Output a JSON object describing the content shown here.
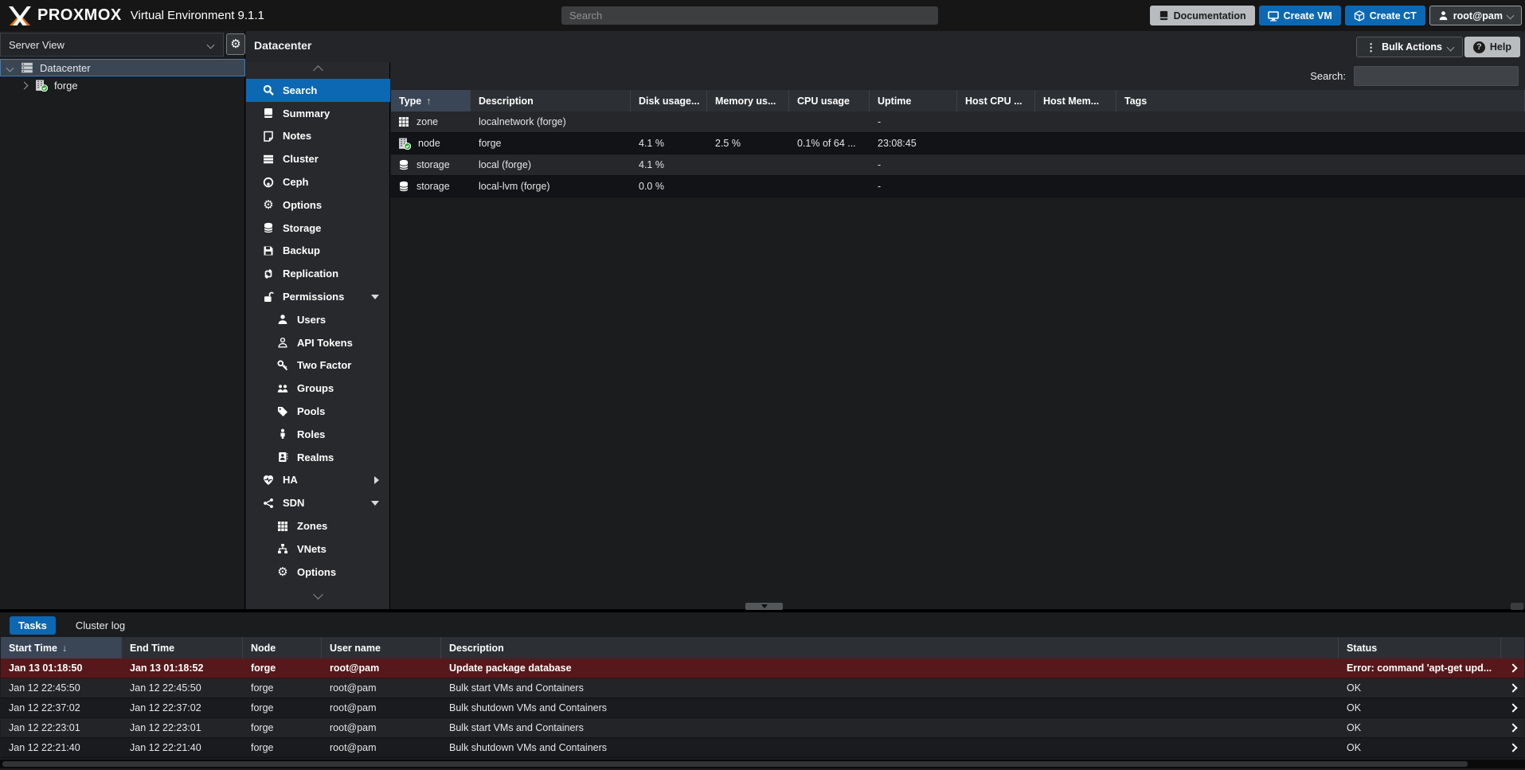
{
  "header": {
    "brand": "PROXMOX",
    "subtitle": "Virtual Environment 9.1.1",
    "search_placeholder": "Search",
    "documentation": "Documentation",
    "create_vm": "Create VM",
    "create_ct": "Create CT",
    "user": "root@pam"
  },
  "sidebar": {
    "view_selector": "Server View",
    "tree": [
      {
        "label": "Datacenter",
        "icon": "server-icon",
        "selected": true,
        "expander": "down",
        "indent": 0
      },
      {
        "label": "forge",
        "icon": "node-icon",
        "selected": false,
        "expander": "right",
        "indent": 1
      }
    ]
  },
  "toolbar": {
    "title": "Datacenter",
    "bulk_actions": "Bulk Actions",
    "help": "Help"
  },
  "nav": {
    "items": [
      {
        "label": "Search",
        "icon": "search-icon",
        "indent": 0,
        "selected": true,
        "caret": ""
      },
      {
        "label": "Summary",
        "icon": "book-icon",
        "indent": 0,
        "selected": false,
        "caret": ""
      },
      {
        "label": "Notes",
        "icon": "note-icon",
        "indent": 0,
        "selected": false,
        "caret": ""
      },
      {
        "label": "Cluster",
        "icon": "cluster-icon",
        "indent": 0,
        "selected": false,
        "caret": ""
      },
      {
        "label": "Ceph",
        "icon": "ceph-icon",
        "indent": 0,
        "selected": false,
        "caret": ""
      },
      {
        "label": "Options",
        "icon": "gear-icon",
        "indent": 0,
        "selected": false,
        "caret": ""
      },
      {
        "label": "Storage",
        "icon": "storage-icon",
        "indent": 0,
        "selected": false,
        "caret": ""
      },
      {
        "label": "Backup",
        "icon": "backup-icon",
        "indent": 0,
        "selected": false,
        "caret": ""
      },
      {
        "label": "Replication",
        "icon": "replication-icon",
        "indent": 0,
        "selected": false,
        "caret": ""
      },
      {
        "label": "Permissions",
        "icon": "unlock-icon",
        "indent": 0,
        "selected": false,
        "caret": "down"
      },
      {
        "label": "Users",
        "icon": "user-icon",
        "indent": 1,
        "selected": false,
        "caret": ""
      },
      {
        "label": "API Tokens",
        "icon": "user-outline-icon",
        "indent": 1,
        "selected": false,
        "caret": ""
      },
      {
        "label": "Two Factor",
        "icon": "key-icon",
        "indent": 1,
        "selected": false,
        "caret": ""
      },
      {
        "label": "Groups",
        "icon": "users-icon",
        "indent": 1,
        "selected": false,
        "caret": ""
      },
      {
        "label": "Pools",
        "icon": "tag-icon",
        "indent": 1,
        "selected": false,
        "caret": ""
      },
      {
        "label": "Roles",
        "icon": "person-icon",
        "indent": 1,
        "selected": false,
        "caret": ""
      },
      {
        "label": "Realms",
        "icon": "address-book-icon",
        "indent": 1,
        "selected": false,
        "caret": ""
      },
      {
        "label": "HA",
        "icon": "heartbeat-icon",
        "indent": 0,
        "selected": false,
        "caret": "right"
      },
      {
        "label": "SDN",
        "icon": "sdn-icon",
        "indent": 0,
        "selected": false,
        "caret": "down"
      },
      {
        "label": "Zones",
        "icon": "grid-icon",
        "indent": 1,
        "selected": false,
        "caret": ""
      },
      {
        "label": "VNets",
        "icon": "vnet-icon",
        "indent": 1,
        "selected": false,
        "caret": ""
      },
      {
        "label": "Options",
        "icon": "gear-icon",
        "indent": 1,
        "selected": false,
        "caret": ""
      }
    ]
  },
  "content": {
    "search_label": "Search:",
    "search_value": "",
    "columns": [
      "Type",
      "Description",
      "Disk usage...",
      "Memory us...",
      "CPU usage",
      "Uptime",
      "Host CPU ...",
      "Host Mem...",
      "Tags"
    ],
    "sort_column": "Type",
    "sort_dir": "up",
    "rows": [
      {
        "type": "zone",
        "icon": "zone-icon",
        "description": "localnetwork (forge)",
        "disk_usage": "",
        "memory_usage": "",
        "cpu_usage": "",
        "uptime": "-",
        "host_cpu": "",
        "host_mem": "",
        "tags": ""
      },
      {
        "type": "node",
        "icon": "node-icon",
        "description": "forge",
        "disk_usage": "4.1 %",
        "memory_usage": "2.5 %",
        "cpu_usage": "0.1% of 64 ...",
        "uptime": "23:08:45",
        "host_cpu": "",
        "host_mem": "",
        "tags": ""
      },
      {
        "type": "storage",
        "icon": "storage-icon",
        "description": "local (forge)",
        "disk_usage": "4.1 %",
        "memory_usage": "",
        "cpu_usage": "",
        "uptime": "-",
        "host_cpu": "",
        "host_mem": "",
        "tags": ""
      },
      {
        "type": "storage",
        "icon": "storage-icon",
        "description": "local-lvm (forge)",
        "disk_usage": "0.0 %",
        "memory_usage": "",
        "cpu_usage": "",
        "uptime": "-",
        "host_cpu": "",
        "host_mem": "",
        "tags": ""
      }
    ]
  },
  "tasks": {
    "tabs": [
      {
        "label": "Tasks",
        "active": true
      },
      {
        "label": "Cluster log",
        "active": false
      }
    ],
    "columns": [
      "Start Time",
      "End Time",
      "Node",
      "User name",
      "Description",
      "Status"
    ],
    "sort_column": "Start Time",
    "sort_dir": "down",
    "rows": [
      {
        "start_time": "Jan 13 01:18:50",
        "end_time": "Jan 13 01:18:52",
        "node": "forge",
        "user_name": "root@pam",
        "description": "Update package database",
        "status": "Error: command 'apt-get upd...",
        "error": true
      },
      {
        "start_time": "Jan 12 22:45:50",
        "end_time": "Jan 12 22:45:50",
        "node": "forge",
        "user_name": "root@pam",
        "description": "Bulk start VMs and Containers",
        "status": "OK",
        "error": false
      },
      {
        "start_time": "Jan 12 22:37:02",
        "end_time": "Jan 12 22:37:02",
        "node": "forge",
        "user_name": "root@pam",
        "description": "Bulk shutdown VMs and Containers",
        "status": "OK",
        "error": false
      },
      {
        "start_time": "Jan 12 22:23:01",
        "end_time": "Jan 12 22:23:01",
        "node": "forge",
        "user_name": "root@pam",
        "description": "Bulk start VMs and Containers",
        "status": "OK",
        "error": false
      },
      {
        "start_time": "Jan 12 22:21:40",
        "end_time": "Jan 12 22:21:40",
        "node": "forge",
        "user_name": "root@pam",
        "description": "Bulk shutdown VMs and Containers",
        "status": "OK",
        "error": false
      }
    ]
  },
  "colors": {
    "accent_blue": "#0c68b3",
    "brand_orange": "#e57000",
    "error_row": "#57181b",
    "header_cell": "#2c3034",
    "sorted_cell": "#3a4656"
  }
}
